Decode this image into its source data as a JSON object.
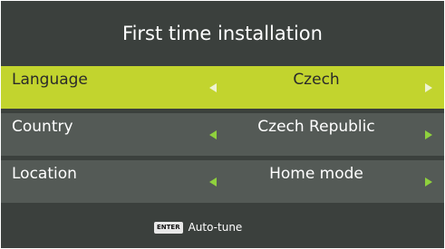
{
  "title": "First time installation",
  "rows": [
    {
      "label": "Language",
      "value": "Czech",
      "selected": true
    },
    {
      "label": "Country",
      "value": "Czech Republic",
      "selected": false
    },
    {
      "label": "Location",
      "value": "Home mode",
      "selected": false
    }
  ],
  "footer": {
    "key": "ENTER",
    "action": "Auto-tune"
  },
  "colors": {
    "panel": "#3b403d",
    "row": "#545a56",
    "selected_row": "#c2d42e",
    "arrow": "#8fd13d"
  },
  "icons": {
    "left": "arrow-left-icon",
    "right": "arrow-right-icon"
  }
}
